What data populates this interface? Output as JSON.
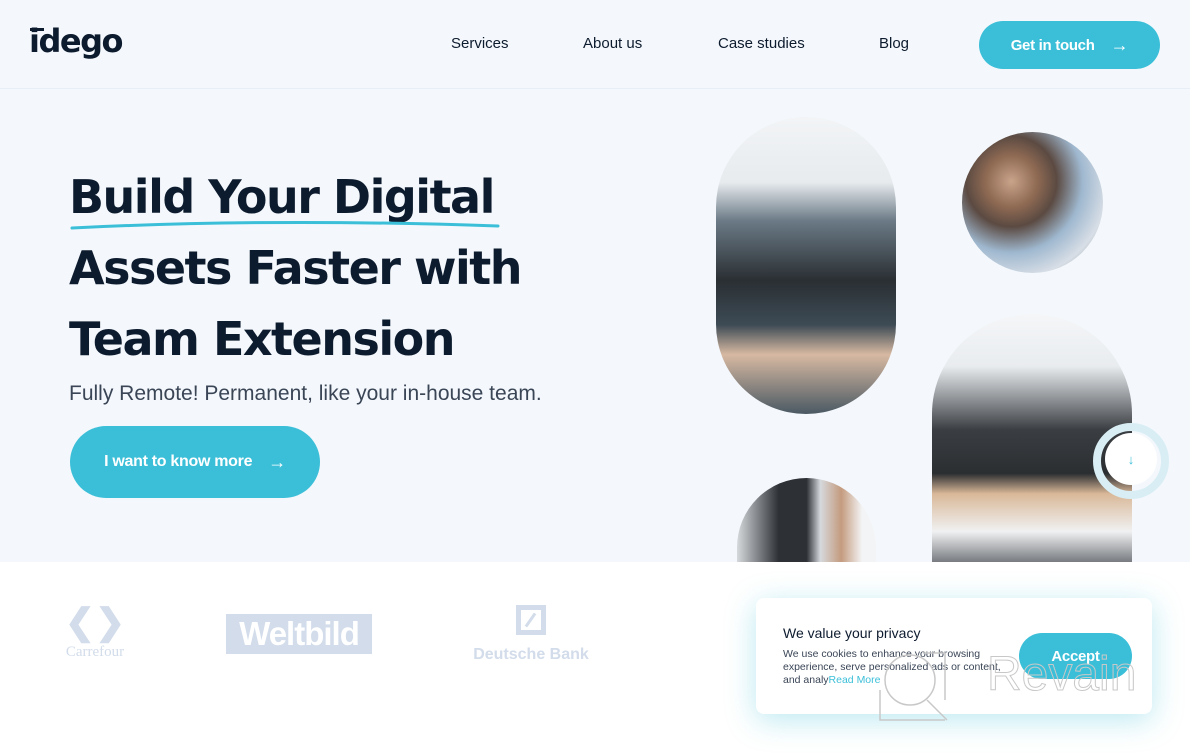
{
  "header": {
    "logo": "idego",
    "nav": [
      {
        "label": "Services"
      },
      {
        "label": "About us"
      },
      {
        "label": "Case studies"
      },
      {
        "label": "Blog"
      }
    ],
    "cta_label": "Get in touch",
    "cta_icon": "arrow-right-icon"
  },
  "hero": {
    "title_lines": [
      "Build Your Digital",
      "Assets Faster with",
      "Team Extension"
    ],
    "subtitle": "Fully Remote! Permanent, like your in-house team.",
    "button_label": "I want to know more",
    "button_icon": "arrow-right-icon",
    "scroll_icon": "arrow-down-icon"
  },
  "photos": [
    {
      "alt": "Team members smiling while playing a video game"
    },
    {
      "alt": "Two colleagues smiling at a screen"
    },
    {
      "alt": "Woman working on a laptop at an office desk"
    },
    {
      "alt": "Man working at a computer monitor"
    }
  ],
  "clients": [
    {
      "name": "Carrefour"
    },
    {
      "name": "Weltbild"
    },
    {
      "name": "Deutsche Bank"
    }
  ],
  "cookie": {
    "title": "We value your privacy",
    "text": "We use cookies to enhance your browsing experience, serve personalized ads or content, and analy",
    "read_more": "Read More",
    "accept_label": "Accept"
  },
  "watermark": "Revain",
  "colors": {
    "accent": "#3bbfd8",
    "text_dark": "#0d1b2e",
    "background": "#f4f8fc",
    "logo_muted": "#d2dcea"
  }
}
